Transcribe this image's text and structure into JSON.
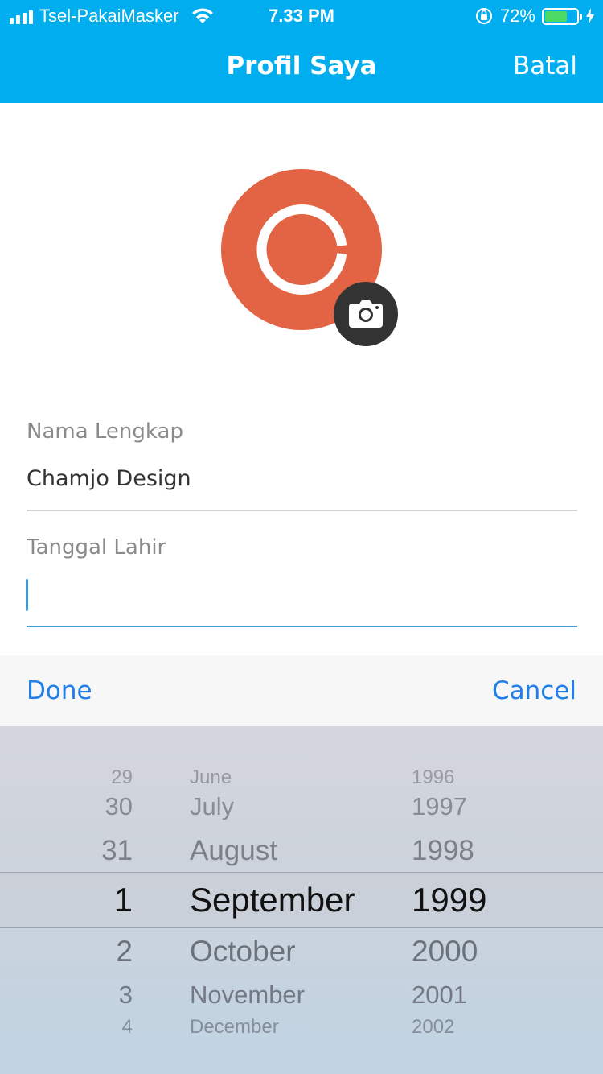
{
  "status_bar": {
    "carrier": "Tsel-PakaiMasker",
    "time": "7.33 PM",
    "battery_percent": "72%",
    "battery_level": 0.72,
    "battery_color": "#4cd964"
  },
  "nav": {
    "title": "Profil Saya",
    "cancel_label": "Batal",
    "background": "#00aeef"
  },
  "avatar": {
    "color": "#e36445",
    "camera_icon": "camera-icon"
  },
  "form": {
    "name_label": "Nama Lengkap",
    "name_value": "Chamjo Design",
    "dob_label": "Tanggal Lahir",
    "dob_value": ""
  },
  "toolbar": {
    "done_label": "Done",
    "cancel_label": "Cancel",
    "accent": "#1f7ee8"
  },
  "picker": {
    "days": [
      "29",
      "30",
      "31",
      "1",
      "2",
      "3",
      "4"
    ],
    "months": [
      "June",
      "July",
      "August",
      "September",
      "October",
      "November",
      "December"
    ],
    "years": [
      "1996",
      "1997",
      "1998",
      "1999",
      "2000",
      "2001",
      "2002"
    ],
    "selected": {
      "day": "1",
      "month": "September",
      "year": "1999"
    }
  }
}
